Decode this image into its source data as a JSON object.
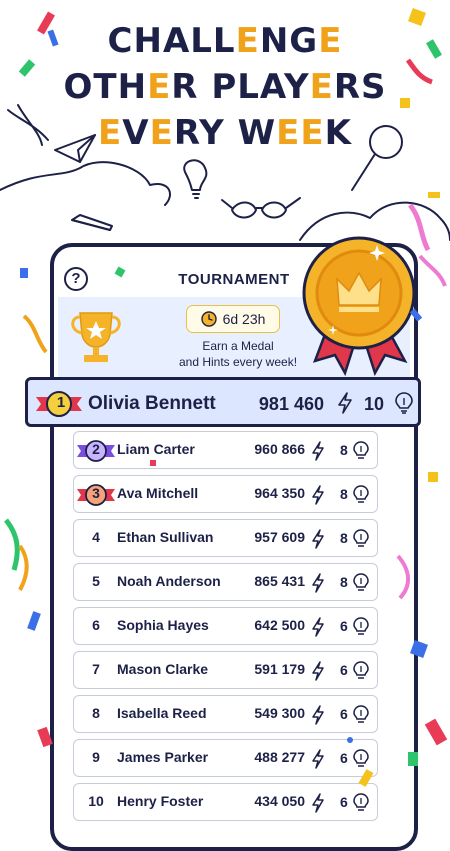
{
  "headline": {
    "line1": [
      "CHALL",
      "E",
      "NG",
      "E"
    ],
    "line2": [
      "OTH",
      "E",
      "R PLAY",
      "E",
      "RS"
    ],
    "line3": [
      "",
      "E",
      "V",
      "E",
      "RY W",
      "EE",
      "K"
    ]
  },
  "screen": {
    "title": "TOURNAMENT",
    "help_label": "?",
    "timer": "6d 23h",
    "banner_line1": "Earn a Medal",
    "banner_line2": "and Hints every week!"
  },
  "leader": {
    "rank": "1",
    "name": "Olivia Bennett",
    "score": "981 460",
    "hints": "10"
  },
  "players": [
    {
      "rank": "2",
      "name": "Liam Carter",
      "score": "960 866",
      "hints": "8",
      "badge": "purple"
    },
    {
      "rank": "3",
      "name": "Ava Mitchell",
      "score": "964 350",
      "hints": "8",
      "badge": "bronze"
    },
    {
      "rank": "4",
      "name": "Ethan Sullivan",
      "score": "957 609",
      "hints": "8"
    },
    {
      "rank": "5",
      "name": "Noah Anderson",
      "score": "865 431",
      "hints": "8"
    },
    {
      "rank": "6",
      "name": "Sophia Hayes",
      "score": "642 500",
      "hints": "6"
    },
    {
      "rank": "7",
      "name": "Mason Clarke",
      "score": "591 179",
      "hints": "6"
    },
    {
      "rank": "8",
      "name": "Isabella Reed",
      "score": "549 300",
      "hints": "6"
    },
    {
      "rank": "9",
      "name": "James Parker",
      "score": "488 277",
      "hints": "6"
    },
    {
      "rank": "10",
      "name": "Henry Foster",
      "score": "434 050",
      "hints": "6"
    }
  ],
  "icons": {
    "timer": "clock-icon",
    "hint": "lightbulb-icon",
    "energy": "lightning-icon",
    "trophy": "trophy-icon",
    "medal": "gold-medal-icon",
    "help": "question-icon"
  },
  "colors": {
    "navy": "#1d2147",
    "gold": "#f0a21a",
    "highlight": "#dde6ff",
    "banner": "#e8efff"
  }
}
